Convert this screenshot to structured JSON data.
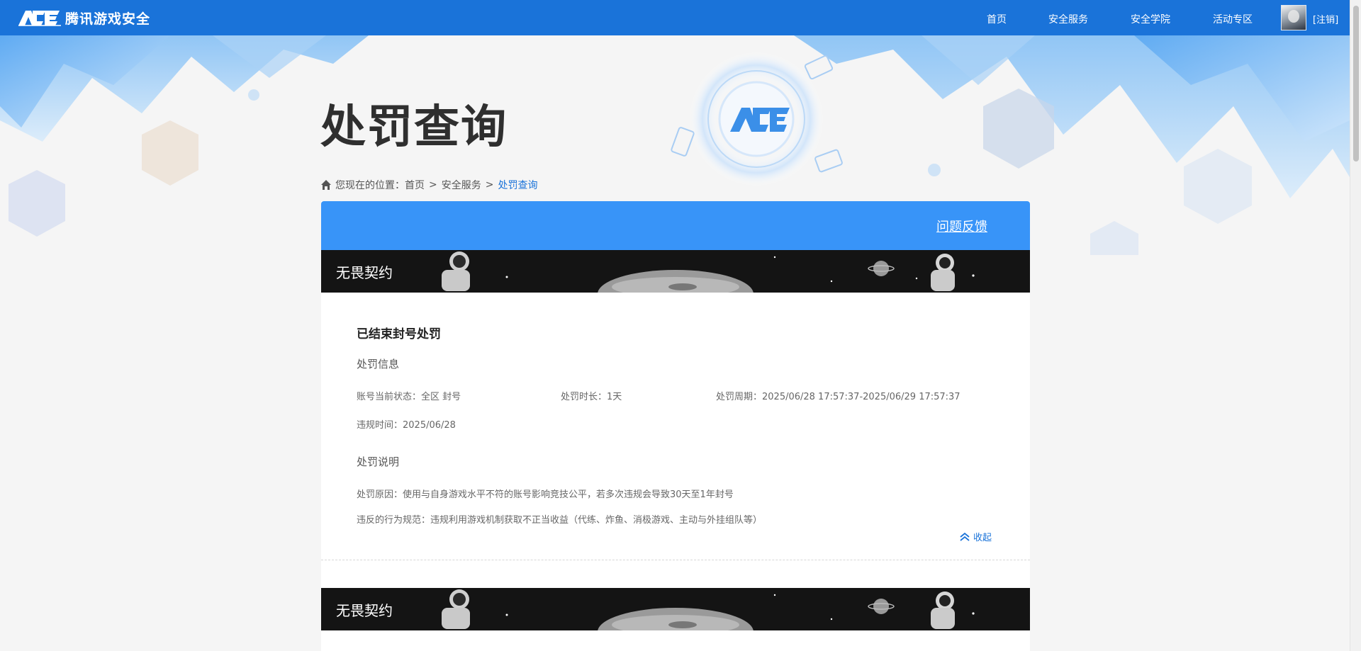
{
  "header": {
    "brand_name": "腾讯游戏安全",
    "nav": [
      "首页",
      "安全服务",
      "安全学院",
      "活动专区"
    ],
    "logout": "[注销]"
  },
  "page": {
    "title": "处罚查询"
  },
  "breadcrumb": {
    "prefix": "您现在的位置：",
    "items": [
      "首页",
      "安全服务",
      "处罚查询"
    ],
    "separator": ">"
  },
  "panel": {
    "feedback_link": "问题反馈"
  },
  "records": [
    {
      "game_name": "无畏契约",
      "status_title": "已结束封号处罚",
      "info_title": "处罚信息",
      "account_status": "账号当前状态：全区 封号",
      "duration": "处罚时长：1天",
      "period": "处罚周期：2025/06/28 17:57:37-2025/06/29 17:57:37",
      "violation_time": "违规时间：2025/06/28",
      "explain_title": "处罚说明",
      "reason": "处罚原因：使用与自身游戏水平不符的账号影响竞技公平，若多次违规会导致30天至1年封号",
      "rule": "违反的行为规范：违规利用游戏机制获取不正当收益（代练、炸鱼、消极游戏、主动与外挂组队等）",
      "collapse_label": "收起"
    },
    {
      "game_name": "无畏契约"
    }
  ],
  "colors": {
    "header_bg": "#1a73d9",
    "panel_head_bg": "#3894f8",
    "accent_link": "#1a73d9",
    "page_bg": "#f5f5f5"
  },
  "icons": [
    "ace-logo-icon",
    "home-icon",
    "chevron-up-double-icon",
    "user-avatar"
  ]
}
